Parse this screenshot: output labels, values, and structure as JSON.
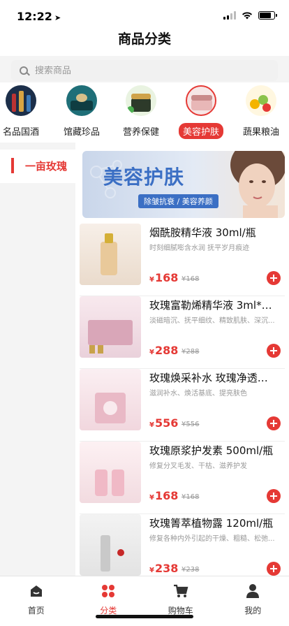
{
  "status_bar": {
    "time": "12:22"
  },
  "nav": {
    "title": "商品分类"
  },
  "search": {
    "placeholder": "搜索商品"
  },
  "categories": [
    {
      "label": "名品国酒",
      "icon": "liquor-bottles-icon"
    },
    {
      "label": "馆藏珍品",
      "icon": "treasure-icon"
    },
    {
      "label": "营养保健",
      "icon": "health-jar-icon"
    },
    {
      "label": "美容护肤",
      "icon": "skincare-jar-icon",
      "active": true
    },
    {
      "label": "蔬果粮油",
      "icon": "fruits-icon"
    }
  ],
  "sidebar": {
    "items": [
      {
        "label": "一亩玫瑰",
        "active": true
      }
    ]
  },
  "banner": {
    "title": "美容护肤",
    "subtitle": "除皱抗衰 / 美容养颜"
  },
  "products": [
    {
      "name": "烟酰胺精华液 30ml/瓶",
      "desc": "时刻细腻嘭含水润 抚平岁月痕迹",
      "price": "168",
      "old_price": "168",
      "currency": "¥"
    },
    {
      "name": "玫瑰富勒烯精华液 3ml*4...",
      "desc": "淡磁暗沉、抚平细纹、精致肌肤、深沉...",
      "price": "288",
      "old_price": "288",
      "currency": "¥"
    },
    {
      "name": "玫瑰焕采补水 玫瑰净透菁...",
      "desc": "滋润补水、焕活基底、提亮肤色",
      "price": "556",
      "old_price": "556",
      "currency": "¥"
    },
    {
      "name": "玫瑰原浆护发素 500ml/瓶",
      "desc": "修复分叉毛发、干枯、滋养护发",
      "price": "168",
      "old_price": "168",
      "currency": "¥"
    },
    {
      "name": "玫瑰箐萃植物露 120ml/瓶",
      "desc": "修复各种内外引起的干燥、粗糙、松弛...",
      "price": "238",
      "old_price": "238",
      "currency": "¥"
    }
  ],
  "tabs": [
    {
      "label": "首页",
      "icon": "home-icon"
    },
    {
      "label": "分类",
      "icon": "category-icon",
      "active": true
    },
    {
      "label": "购物车",
      "icon": "cart-icon"
    },
    {
      "label": "我的",
      "icon": "user-icon"
    }
  ],
  "colors": {
    "accent": "#e53935",
    "banner_title": "#3b6fc4"
  }
}
